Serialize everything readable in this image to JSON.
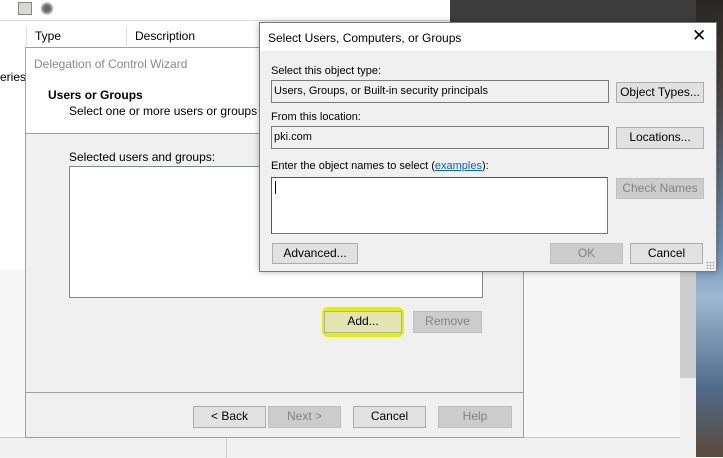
{
  "background_app": {
    "columns": [
      "Type",
      "Description"
    ],
    "partial_text": "eries"
  },
  "wizard": {
    "title": "Delegation of Control Wizard",
    "heading": "Users or Groups",
    "subheading": "Select one or more users or groups to wh",
    "list_label": "Selected users and groups:",
    "add_label": "Add...",
    "remove_label": "Remove",
    "back_label": "< Back",
    "next_label": "Next >",
    "cancel_label": "Cancel",
    "help_label": "Help",
    "highlight_color": "#e5f000"
  },
  "dialog": {
    "title": "Select Users, Computers, or Groups",
    "object_type_label": "Select this object type:",
    "object_type_value": "Users, Groups, or Built-in security principals",
    "object_types_button": "Object Types...",
    "location_label": "From this location:",
    "location_value": "pki.com",
    "locations_button": "Locations...",
    "names_label_prefix": "Enter the object names to select (",
    "names_link": "examples",
    "names_label_suffix": "):",
    "names_value": "",
    "check_names_button": "Check Names",
    "advanced_button": "Advanced...",
    "ok_button": "OK",
    "cancel_button": "Cancel"
  }
}
